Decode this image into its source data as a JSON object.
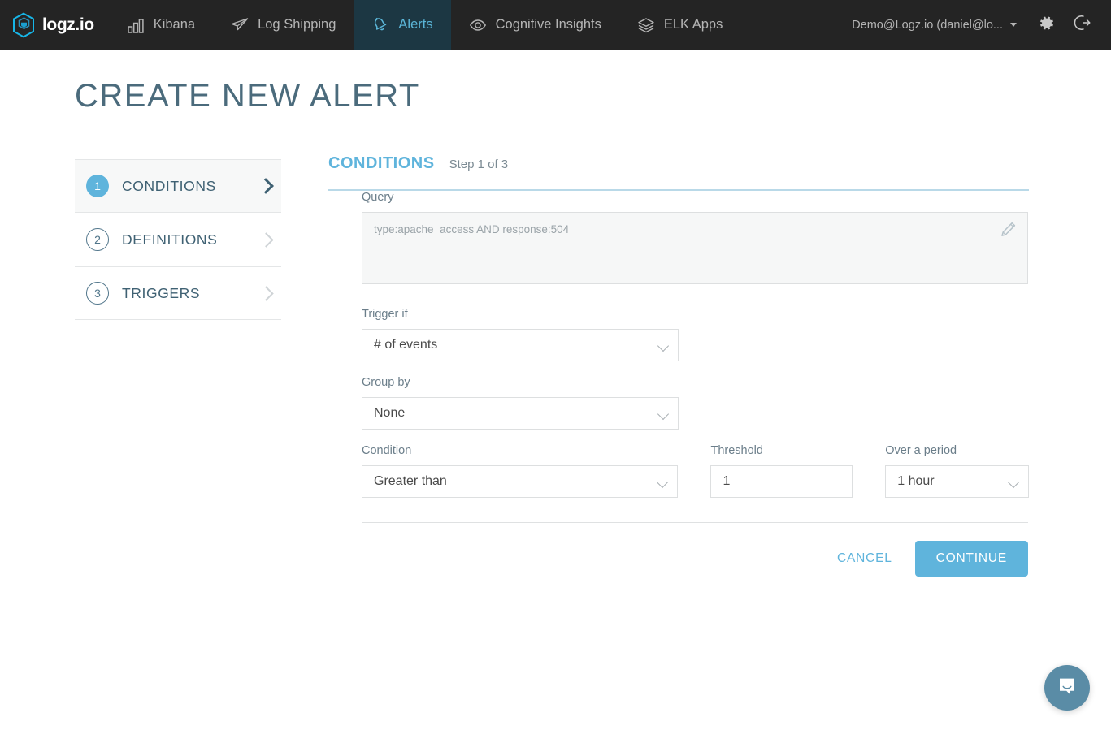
{
  "topnav": {
    "brand": "logz.io",
    "items": [
      {
        "label": "Kibana",
        "icon": "bar-chart-icon",
        "active": false
      },
      {
        "label": "Log Shipping",
        "icon": "paper-plane-icon",
        "active": false
      },
      {
        "label": "Alerts",
        "icon": "bell-icon",
        "active": true
      },
      {
        "label": "Cognitive Insights",
        "icon": "eye-icon",
        "active": false
      },
      {
        "label": "ELK Apps",
        "icon": "layers-icon",
        "active": false
      }
    ],
    "user": "Demo@Logz.io (daniel@lo...",
    "settings_icon": "gear-icon",
    "logout_icon": "logout-icon"
  },
  "page": {
    "title": "CREATE NEW ALERT"
  },
  "steps": [
    {
      "num": "1",
      "label": "CONDITIONS"
    },
    {
      "num": "2",
      "label": "DEFINITIONS"
    },
    {
      "num": "3",
      "label": "TRIGGERS"
    }
  ],
  "panel": {
    "heading": "CONDITIONS",
    "step_text": "Step 1 of 3"
  },
  "form": {
    "query": {
      "label": "Query",
      "placeholder": "type:apache_access AND response:504",
      "value": "",
      "edit_icon": "pencil-icon"
    },
    "trigger_if": {
      "label": "Trigger if",
      "value": "# of events"
    },
    "group_by": {
      "label": "Group by",
      "value": "None"
    },
    "condition": {
      "label": "Condition",
      "value": "Greater than"
    },
    "threshold": {
      "label": "Threshold",
      "value": "1"
    },
    "over_a_period": {
      "label": "Over a period",
      "value": "1 hour"
    }
  },
  "actions": {
    "cancel": "CANCEL",
    "continue": "CONTINUE"
  },
  "chat": {
    "icon": "chat-bubble-icon"
  },
  "colors": {
    "accent": "#5fb4dc",
    "nav_bg": "#242424",
    "nav_active_bg": "#1c3743",
    "title": "#4b6b7c"
  }
}
